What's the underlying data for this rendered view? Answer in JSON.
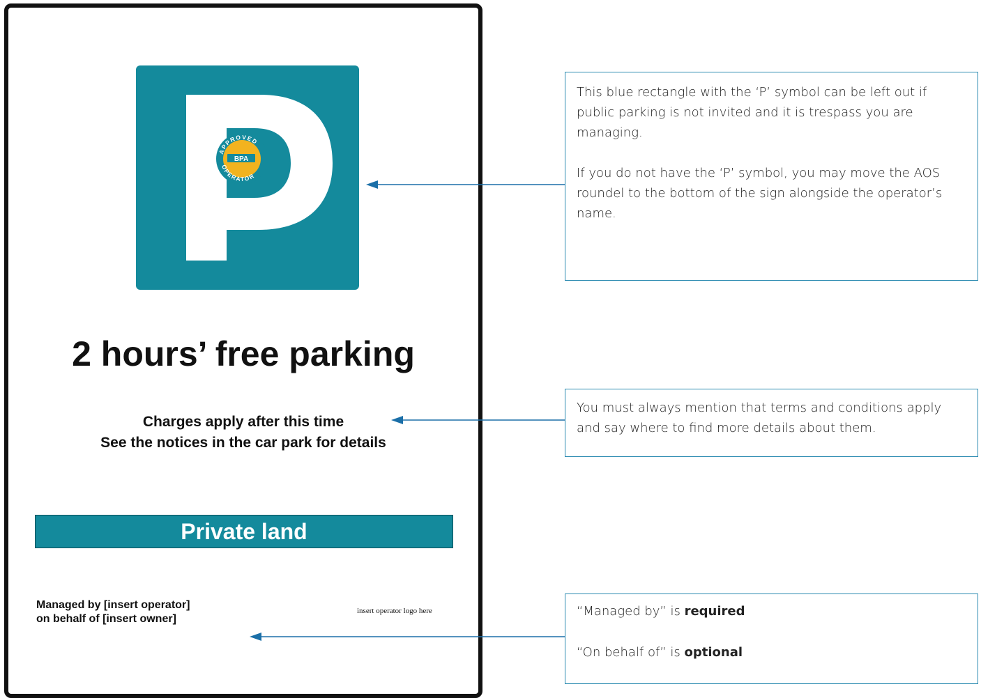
{
  "sign": {
    "headline": "2 hours’ free parking",
    "conditions_line1": "Charges apply after this time",
    "conditions_line2": "See the notices in the car park for details",
    "private_land": "Private land",
    "managed_line1": "Managed by [insert operator]",
    "managed_line2": "on behalf of [insert owner]",
    "logo_placeholder": "insert operator logo here",
    "roundel": {
      "top_text": "APPROVED",
      "bottom_text": "OPERATOR",
      "center_text": "BPA"
    }
  },
  "callouts": {
    "p_symbol": {
      "para1": "This blue rectangle with the ‘P’ symbol can be left out if public parking is not invited and it is trespass you are managing.",
      "para2": "If you do not have the ‘P’ symbol, you may move the AOS roundel to the bottom of the sign alongside the operator’s name."
    },
    "terms": {
      "text": "You must always mention that terms and conditions apply and say where to find more details about them."
    },
    "managed": {
      "line1_prefix": "“Managed by” is ",
      "line1_bold": "required",
      "line2_prefix": "“On behalf of” is ",
      "line2_bold": "optional"
    }
  },
  "colors": {
    "sign_teal": "#148a9c",
    "callout_border": "#2a8ab0",
    "arrow": "#1b6fa8",
    "roundel_yellow": "#f2b31f",
    "roundel_ring": "#148a9c"
  },
  "icons": [
    "parking-p-icon",
    "bpa-roundel-icon",
    "arrow-left-icon"
  ]
}
